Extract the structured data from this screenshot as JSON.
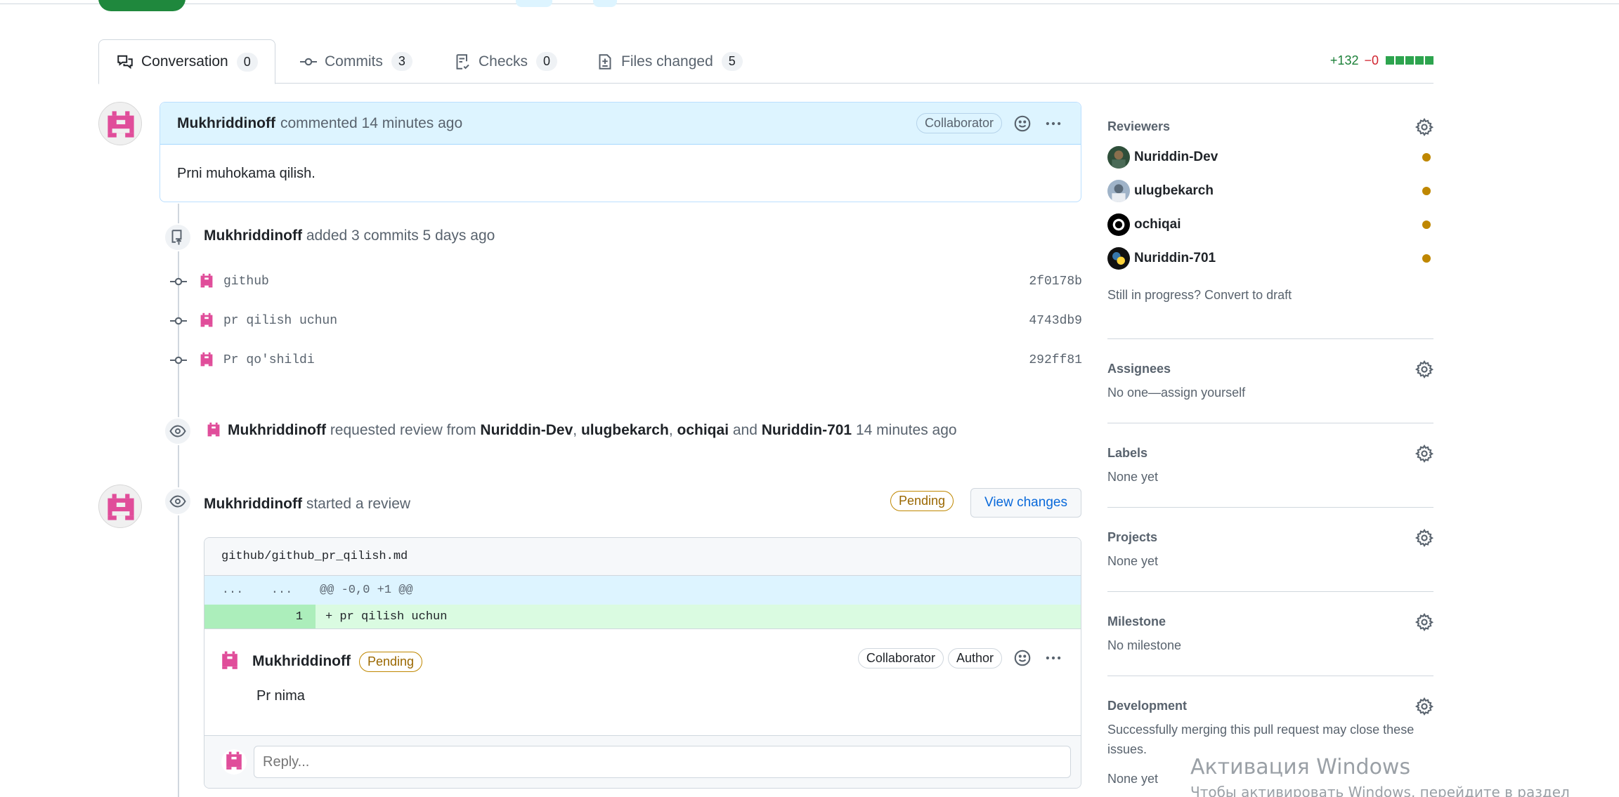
{
  "tabs": [
    {
      "label": "Conversation",
      "count": "0"
    },
    {
      "label": "Commits",
      "count": "3"
    },
    {
      "label": "Checks",
      "count": "0"
    },
    {
      "label": "Files changed",
      "count": "5"
    }
  ],
  "diffstat": {
    "additions": "+132",
    "deletions": "−0"
  },
  "opening_comment": {
    "author": "Mukhriddinoff",
    "action": "commented",
    "time": "14 minutes ago",
    "role": "Collaborator",
    "body": "Prni muhokama qilish."
  },
  "commits_event": {
    "author": "Mukhriddinoff",
    "text": "added 3 commits 5 days ago",
    "commits": [
      {
        "message": "github",
        "sha": "2f0178b"
      },
      {
        "message": "pr qilish uchun",
        "sha": "4743db9"
      },
      {
        "message": "Pr qo'shildi",
        "sha": "292ff81"
      }
    ]
  },
  "review_request": {
    "author": "Mukhriddinoff",
    "text1": "requested review from",
    "r1": "Nuriddin-Dev",
    "sep1": ",",
    "r2": "ulugbekarch",
    "sep2": ",",
    "r3": "ochiqai",
    "and": "and",
    "r4": "Nuriddin-701",
    "time": "14 minutes ago"
  },
  "review": {
    "author": "Mukhriddinoff",
    "text": "started a review",
    "status": "Pending",
    "view_changes": "View changes",
    "file": "github/github_pr_qilish.md",
    "hunk_left": "...",
    "hunk_right": "...",
    "hunk": "@@ -0,0 +1 @@",
    "line_no": "1",
    "line": "+ pr qilish uchun",
    "inline_author": "Mukhriddinoff",
    "inline_status": "Pending",
    "inline_role1": "Collaborator",
    "inline_role2": "Author",
    "inline_body": "Pr nima",
    "reply_placeholder": "Reply..."
  },
  "sidebar": {
    "reviewers_title": "Reviewers",
    "reviewers": [
      "Nuriddin-Dev",
      "ulugbekarch",
      "ochiqai",
      "Nuriddin-701"
    ],
    "draft_text": "Still in progress? Convert to draft",
    "assignees_title": "Assignees",
    "assignees_text": "No one—assign yourself",
    "labels_title": "Labels",
    "labels_text": "None yet",
    "projects_title": "Projects",
    "projects_text": "None yet",
    "milestone_title": "Milestone",
    "milestone_text": "No milestone",
    "development_title": "Development",
    "development_text": "Successfully merging this pull request may close these issues.",
    "development_none": "None yet"
  },
  "watermark": {
    "line1": "Активация Windows",
    "line2": "Чтобы активировать Windows, перейдите в раздел"
  },
  "colors": {
    "accent": "#0969da",
    "pending": "#9a6700",
    "identicon": "#e04d9a",
    "add": "#1a7f37"
  }
}
